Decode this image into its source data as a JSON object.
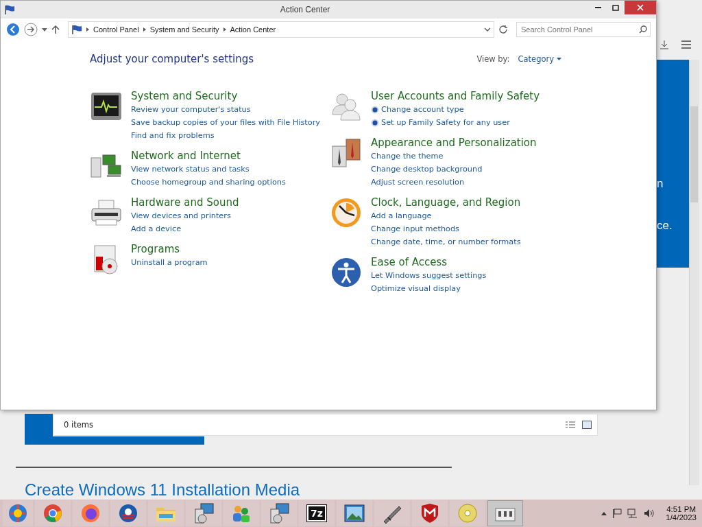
{
  "window": {
    "title": "Action Center"
  },
  "address_bar": {
    "crumbs": [
      "Control Panel",
      "System and Security",
      "Action Center"
    ]
  },
  "search": {
    "placeholder": "Search Control Panel"
  },
  "heading": "Adjust your computer's settings",
  "view_by": {
    "label": "View by:",
    "value": "Category"
  },
  "columns": [
    [
      {
        "kind": "monitor",
        "title": "System and Security",
        "links": [
          {
            "text": "Review your computer's status",
            "shield": false
          },
          {
            "text": "Save backup copies of your files with File History",
            "shield": false
          },
          {
            "text": "Find and fix problems",
            "shield": false
          }
        ]
      },
      {
        "kind": "network",
        "title": "Network and Internet",
        "links": [
          {
            "text": "View network status and tasks",
            "shield": false
          },
          {
            "text": "Choose homegroup and sharing options",
            "shield": false
          }
        ]
      },
      {
        "kind": "printer",
        "title": "Hardware and Sound",
        "links": [
          {
            "text": "View devices and printers",
            "shield": false
          },
          {
            "text": "Add a device",
            "shield": false
          }
        ]
      },
      {
        "kind": "programs",
        "title": "Programs",
        "links": [
          {
            "text": "Uninstall a program",
            "shield": false
          }
        ]
      }
    ],
    [
      {
        "kind": "users",
        "title": "User Accounts and Family Safety",
        "links": [
          {
            "text": "Change account type",
            "shield": true
          },
          {
            "text": "Set up Family Safety for any user",
            "shield": true
          }
        ]
      },
      {
        "kind": "appearance",
        "title": "Appearance and Personalization",
        "links": [
          {
            "text": "Change the theme",
            "shield": false
          },
          {
            "text": "Change desktop background",
            "shield": false
          },
          {
            "text": "Adjust screen resolution",
            "shield": false
          }
        ]
      },
      {
        "kind": "clock",
        "title": "Clock, Language, and Region",
        "links": [
          {
            "text": "Add a language",
            "shield": false
          },
          {
            "text": "Change input methods",
            "shield": false
          },
          {
            "text": "Change date, time, or number formats",
            "shield": false
          }
        ]
      },
      {
        "kind": "access",
        "title": "Ease of Access",
        "links": [
          {
            "text": "Let Windows suggest settings",
            "shield": false
          },
          {
            "text": "Optimize visual display",
            "shield": false
          }
        ]
      }
    ]
  ],
  "status_bar": {
    "text": "0 items"
  },
  "background_page": {
    "fragments": [
      "n",
      "ce."
    ],
    "link": "Create Windows 11 Installation Media"
  },
  "taskbar": {
    "apps": [
      {
        "kind": "ball",
        "selected": false
      },
      {
        "kind": "chrome",
        "selected": false
      },
      {
        "kind": "firefox",
        "selected": false
      },
      {
        "kind": "round",
        "selected": false
      },
      {
        "kind": "folder",
        "selected": false
      },
      {
        "kind": "setup",
        "selected": false
      },
      {
        "kind": "people",
        "selected": false
      },
      {
        "kind": "setup",
        "selected": false
      },
      {
        "kind": "archiver",
        "label": "7z",
        "selected": false
      },
      {
        "kind": "photo",
        "selected": false
      },
      {
        "kind": "tool",
        "selected": false
      },
      {
        "kind": "shield",
        "selected": false
      },
      {
        "kind": "disc",
        "selected": false
      },
      {
        "kind": "panel",
        "selected": true
      }
    ],
    "time": "4:51 PM",
    "date": "1/4/2023"
  }
}
